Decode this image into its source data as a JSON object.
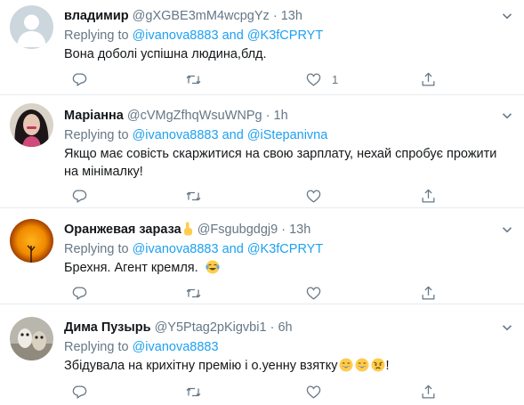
{
  "tweets": [
    {
      "name": "владимир",
      "handle": "@gXGBE3mM4wcpgYz",
      "time": "13h",
      "reply_prefix": "Replying to",
      "reply_user1": "@ivanova8883",
      "reply_and": "and",
      "reply_user2": "@K3fCPRYT",
      "text": "Вона доболі успішна людина,блд.",
      "likes": "1"
    },
    {
      "name": "Маріанна",
      "handle": "@cVMgZfhqWsuWNPg",
      "time": "1h",
      "reply_prefix": "Replying to",
      "reply_user1": "@ivanova8883",
      "reply_and": "and",
      "reply_user2": "@iStepanivna",
      "text": "Якщо має совість скаржитися на свою зарплату, нехай спробує прожити на мінімалку!",
      "likes": ""
    },
    {
      "name": "Оранжевая зараза",
      "handle": "@Fsgubgdgj9",
      "time": "13h",
      "reply_prefix": "Replying to",
      "reply_user1": "@ivanova8883",
      "reply_and": "and",
      "reply_user2": "@K3fCPRYT",
      "text": "Брехня. Агент кремля.",
      "likes": ""
    },
    {
      "name": "Дима Пузырь",
      "handle": "@Y5Ptag2pKigvbi1",
      "time": "6h",
      "reply_prefix": "Replying to",
      "reply_user1": "@ivanova8883",
      "text": "Збідувала на крихітну премію і о.уенну взятку",
      "text_suffix": "!",
      "likes": ""
    }
  ],
  "separator": "·",
  "icons": [
    "default-avatar",
    "chevron-down-icon",
    "reply-icon",
    "retweet-icon",
    "like-icon",
    "share-icon",
    "point-up-emoji",
    "tears-of-joy-emoji",
    "grinning-emoji",
    "angry-emoji"
  ],
  "colors": {
    "link": "#1da1f2",
    "secondary": "#657786",
    "text": "#14171a",
    "divider": "#e6ecf0"
  }
}
